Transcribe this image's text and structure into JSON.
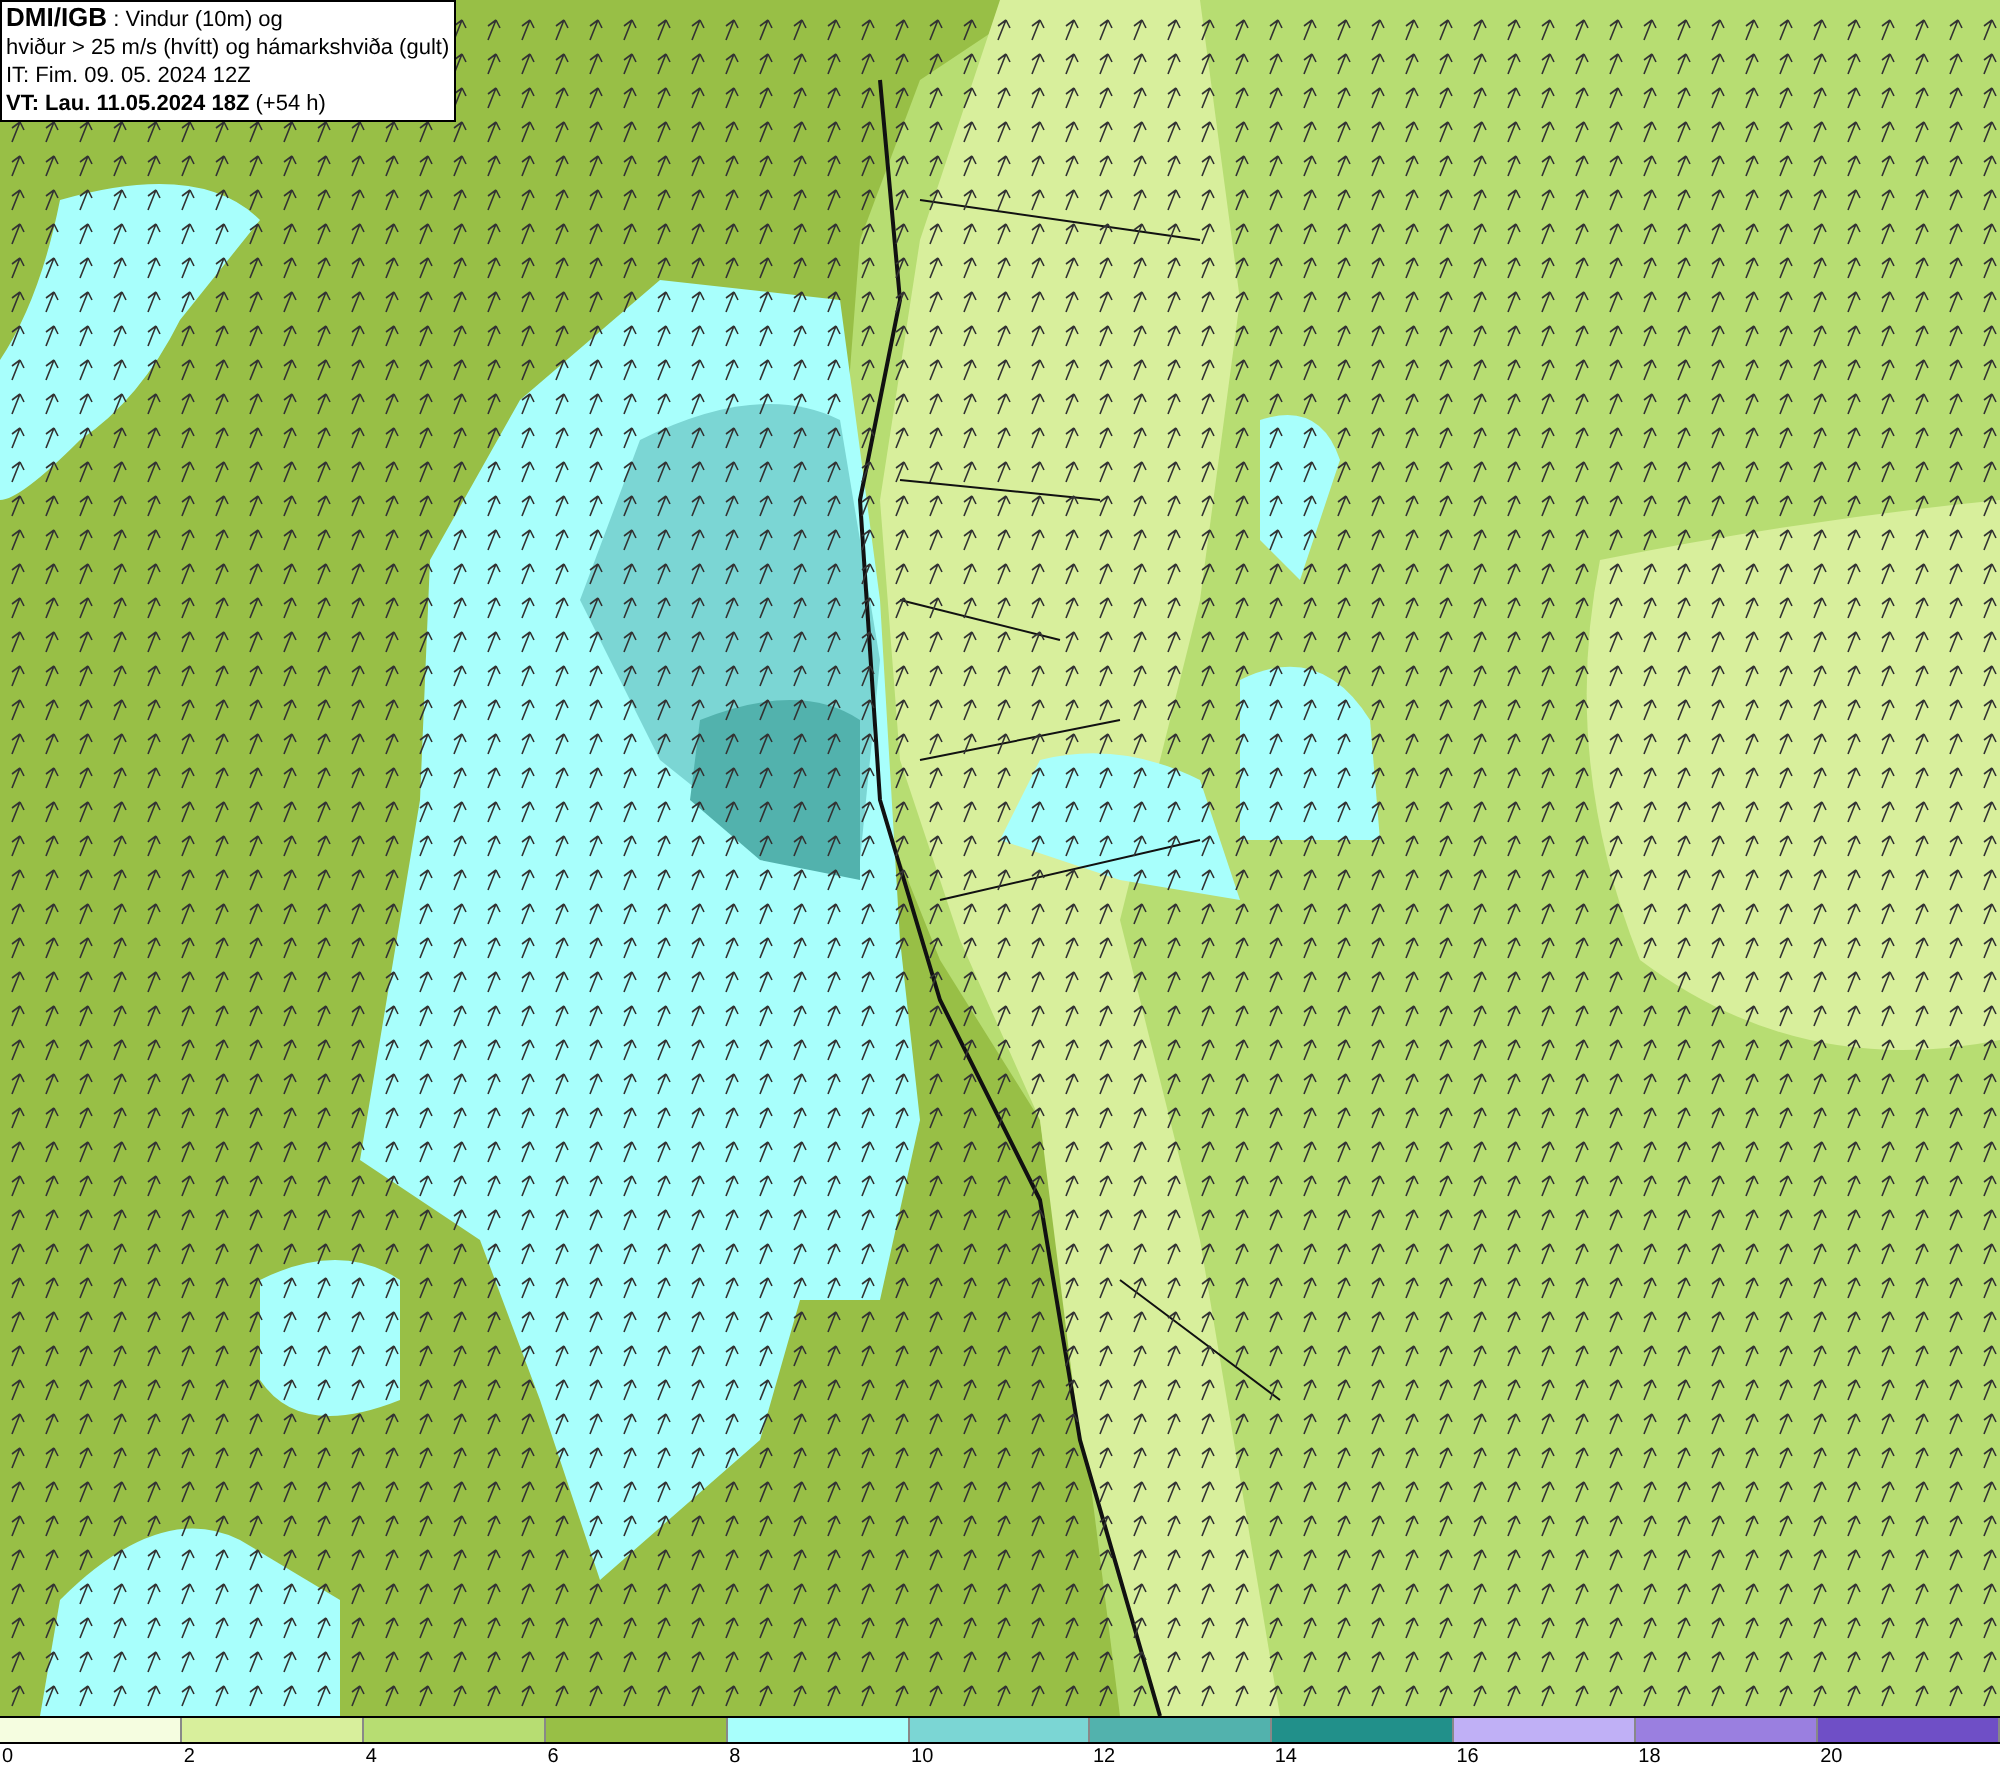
{
  "header": {
    "source": "DMI/IGB",
    "title_rest": ": Vindur (10m) og",
    "subtitle": "hviður > 25 m/s (hvítt) og hámarkshviða (gult)",
    "initial_time": "IT: Fim. 09. 05. 2024 12Z",
    "valid_time": "VT: Lau. 11.05.2024 18Z",
    "lead": "(+54 h)"
  },
  "legend": {
    "bins": [
      {
        "color": "#f5fde0"
      },
      {
        "color": "#d8ef9c"
      },
      {
        "color": "#b7dd72"
      },
      {
        "color": "#98bf46"
      },
      {
        "color": "#a8fffc"
      },
      {
        "color": "#7bd6d4"
      },
      {
        "color": "#52b2ad"
      },
      {
        "color": "#21908a"
      },
      {
        "color": "#c0b0f6"
      },
      {
        "color": "#9a7fe0"
      },
      {
        "color": "#6f4fc6"
      }
    ],
    "ticks": [
      "0",
      "2",
      "4",
      "6",
      "8",
      "10",
      "12",
      "14",
      "16",
      "18",
      "20"
    ]
  }
}
